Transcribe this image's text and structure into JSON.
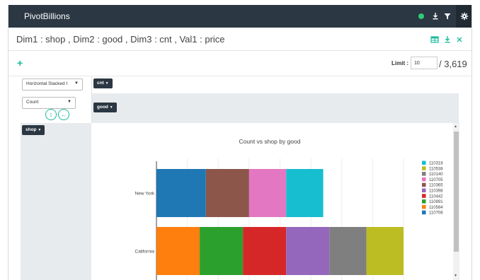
{
  "app": {
    "brand": "PivotBillions"
  },
  "navbar": {
    "status_color": "#2ecc71",
    "icons": [
      "status-dot",
      "download-icon",
      "filter-icon",
      "gear-icon"
    ]
  },
  "titlebar": {
    "title": "Dim1 : shop , Dim2 : good , Dim3 : cnt , Val1 : price",
    "icons": [
      "table-icon",
      "download-icon",
      "close-icon"
    ],
    "accent": "#1abc9c"
  },
  "controls": {
    "add_label": "+",
    "limit_label": "Limit :",
    "limit_value": "10",
    "limit_total": "/ 3,619",
    "chart_type": "Horizontal Stacked I",
    "aggregate": "Count",
    "pills": {
      "cnt": "cnt",
      "good": "good",
      "shop": "shop"
    },
    "caret": "▼"
  },
  "chart_data": {
    "type": "bar",
    "orientation": "horizontal",
    "stacked": true,
    "title": "Count vs shop by good",
    "categories": [
      "New York",
      "California"
    ],
    "series": [
      {
        "name": "110708",
        "color": "#1f77b4",
        "values": [
          1.6,
          0
        ]
      },
      {
        "name": "110584",
        "color": "#ff7f0e",
        "values": [
          0,
          1.4
        ]
      },
      {
        "name": "110891",
        "color": "#2ca02c",
        "values": [
          0,
          1.4
        ]
      },
      {
        "name": "110442",
        "color": "#d62728",
        "values": [
          0,
          1.4
        ]
      },
      {
        "name": "110398",
        "color": "#9467bd",
        "values": [
          0,
          1.4
        ]
      },
      {
        "name": "110365",
        "color": "#8c564b",
        "values": [
          1.4,
          0
        ]
      },
      {
        "name": "110705",
        "color": "#e377c2",
        "values": [
          1.2,
          0
        ]
      },
      {
        "name": "110140",
        "color": "#7f7f7f",
        "values": [
          0,
          1.2
        ]
      },
      {
        "name": "110538",
        "color": "#bcbd22",
        "values": [
          0,
          1.2
        ]
      },
      {
        "name": "110318",
        "color": "#17becf",
        "values": [
          1.2,
          0
        ]
      }
    ],
    "legend_order": [
      "110318",
      "110538",
      "110140",
      "110705",
      "110365",
      "110398",
      "110442",
      "110891",
      "110584",
      "110708"
    ],
    "grid": true,
    "legend": "right"
  }
}
